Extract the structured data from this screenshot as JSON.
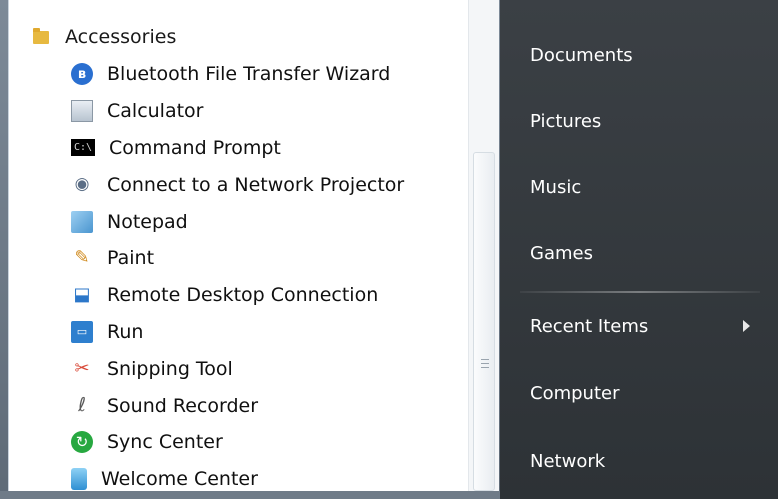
{
  "programs": {
    "folder_label": "Accessories",
    "items": [
      {
        "label": "Bluetooth File Transfer Wizard",
        "icon": "bluetooth-icon"
      },
      {
        "label": "Calculator",
        "icon": "calculator-icon"
      },
      {
        "label": "Command Prompt",
        "icon": "command-prompt-icon"
      },
      {
        "label": "Connect to a Network Projector",
        "icon": "network-projector-icon"
      },
      {
        "label": "Notepad",
        "icon": "notepad-icon"
      },
      {
        "label": "Paint",
        "icon": "paint-icon"
      },
      {
        "label": "Remote Desktop Connection",
        "icon": "remote-desktop-icon"
      },
      {
        "label": "Run",
        "icon": "run-icon"
      },
      {
        "label": "Snipping Tool",
        "icon": "snipping-tool-icon"
      },
      {
        "label": "Sound Recorder",
        "icon": "sound-recorder-icon"
      },
      {
        "label": "Sync Center",
        "icon": "sync-center-icon"
      },
      {
        "label": "Welcome Center",
        "icon": "welcome-center-icon"
      }
    ]
  },
  "places": {
    "documents": "Documents",
    "pictures": "Pictures",
    "music": "Music",
    "games": "Games",
    "recent_items": "Recent Items",
    "computer": "Computer",
    "network": "Network"
  },
  "colors": {
    "right_pane": "#33383d",
    "left_pane": "#ffffff",
    "folder": "#e7b940"
  }
}
